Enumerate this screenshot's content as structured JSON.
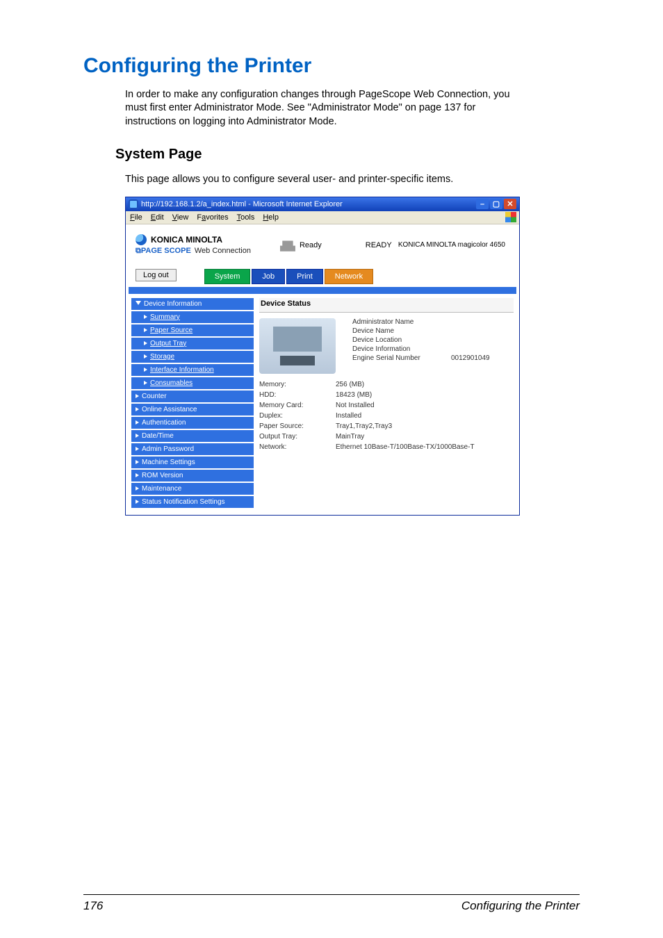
{
  "page": {
    "heading": "Configuring the Printer",
    "intro": "In order to make any configuration changes through PageScope Web Connection, you must first enter Administrator Mode. See \"Administrator Mode\" on page 137 for instructions on logging into Administrator Mode.",
    "subhead": "System Page",
    "subintro": "This page allows you to configure several user- and printer-specific items."
  },
  "footer": {
    "page_number": "176",
    "running": "Configuring the Printer"
  },
  "ie": {
    "titlebar": "http://192.168.1.2/a_index.html - Microsoft Internet Explorer",
    "menu": {
      "file": "File",
      "edit": "Edit",
      "view": "View",
      "favorites": "Favorites",
      "tools": "Tools",
      "help": "Help"
    }
  },
  "header": {
    "brand": "KONICA MINOLTA",
    "pagescope": "Web Connection",
    "status_small": "Ready",
    "status_big": "READY",
    "model": "KONICA MINOLTA magicolor 4650",
    "logout": "Log out",
    "tabs": {
      "system": "System",
      "job": "Job",
      "print": "Print",
      "network": "Network"
    }
  },
  "sidebar": {
    "device_info": "Device Information",
    "items": [
      {
        "label": "Summary"
      },
      {
        "label": "Paper Source"
      },
      {
        "label": "Output Tray"
      },
      {
        "label": "Storage"
      },
      {
        "label": "Interface Information"
      },
      {
        "label": "Consumables"
      }
    ],
    "others": [
      {
        "label": "Counter"
      },
      {
        "label": "Online Assistance"
      },
      {
        "label": "Authentication"
      },
      {
        "label": "Date/Time"
      },
      {
        "label": "Admin Password"
      },
      {
        "label": "Machine Settings"
      },
      {
        "label": "ROM Version"
      },
      {
        "label": "Maintenance"
      },
      {
        "label": "Status Notification Settings"
      }
    ]
  },
  "main": {
    "title": "Device Status",
    "info_labels": {
      "admin_name": "Administrator Name",
      "device_name": "Device Name",
      "device_location": "Device Location",
      "device_information": "Device Information",
      "engine_serial": "Engine Serial Number"
    },
    "info_values": {
      "engine_serial": "0012901049"
    },
    "specs": [
      {
        "k": "Memory:",
        "v": "256 (MB)"
      },
      {
        "k": "HDD:",
        "v": "18423 (MB)"
      },
      {
        "k": "Memory Card:",
        "v": "Not Installed"
      },
      {
        "k": "Duplex:",
        "v": "Installed"
      },
      {
        "k": "Paper Source:",
        "v": "Tray1,Tray2,Tray3"
      },
      {
        "k": "Output Tray:",
        "v": "MainTray"
      },
      {
        "k": "Network:",
        "v": "Ethernet 10Base-T/100Base-TX/1000Base-T"
      }
    ]
  }
}
